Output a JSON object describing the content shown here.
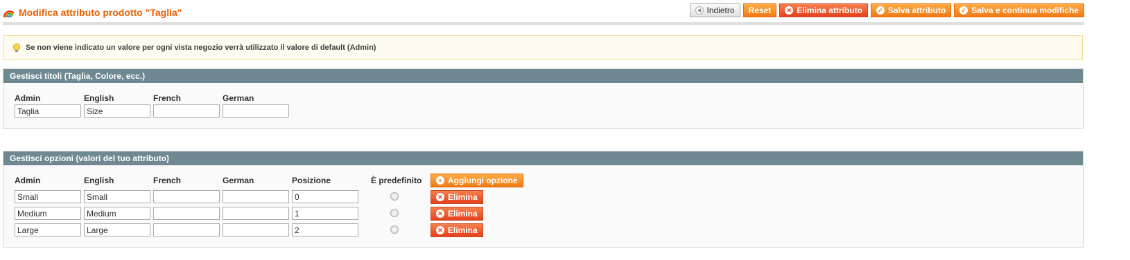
{
  "header": {
    "title": "Modifica attributo prodotto \"Taglia\"",
    "buttons": {
      "back": "Indietro",
      "reset": "Reset",
      "delete": "Elimina attributo",
      "save": "Salva attributo",
      "save_continue": "Salva e continua modifiche"
    }
  },
  "notice": {
    "text": "Se non viene indicato un valore per ogni vista negozio verrà utilizzato il valore di default (Admin)"
  },
  "titles_section": {
    "heading": "Gestisci titoli (Taglia, Colore, ecc.)",
    "columns": [
      "Admin",
      "English",
      "French",
      "German"
    ],
    "values": [
      "Taglia",
      "Size",
      "",
      ""
    ]
  },
  "options_section": {
    "heading": "Gestisci opzioni (valori del tuo attributo)",
    "columns": [
      "Admin",
      "English",
      "French",
      "German",
      "Posizione",
      "È predefinito"
    ],
    "add_button": "Aggiungi opzione",
    "delete_label": "Elimina",
    "rows": [
      {
        "admin": "Small",
        "english": "Small",
        "french": "",
        "german": "",
        "position": "0",
        "is_default": false
      },
      {
        "admin": "Medium",
        "english": "Medium",
        "french": "",
        "german": "",
        "position": "1",
        "is_default": false
      },
      {
        "admin": "Large",
        "english": "Large",
        "french": "",
        "german": "",
        "position": "2",
        "is_default": false
      }
    ]
  },
  "colors": {
    "accent": "#eb5e00",
    "section_header": "#6f8992",
    "notice_bg": "#fffbf0"
  }
}
